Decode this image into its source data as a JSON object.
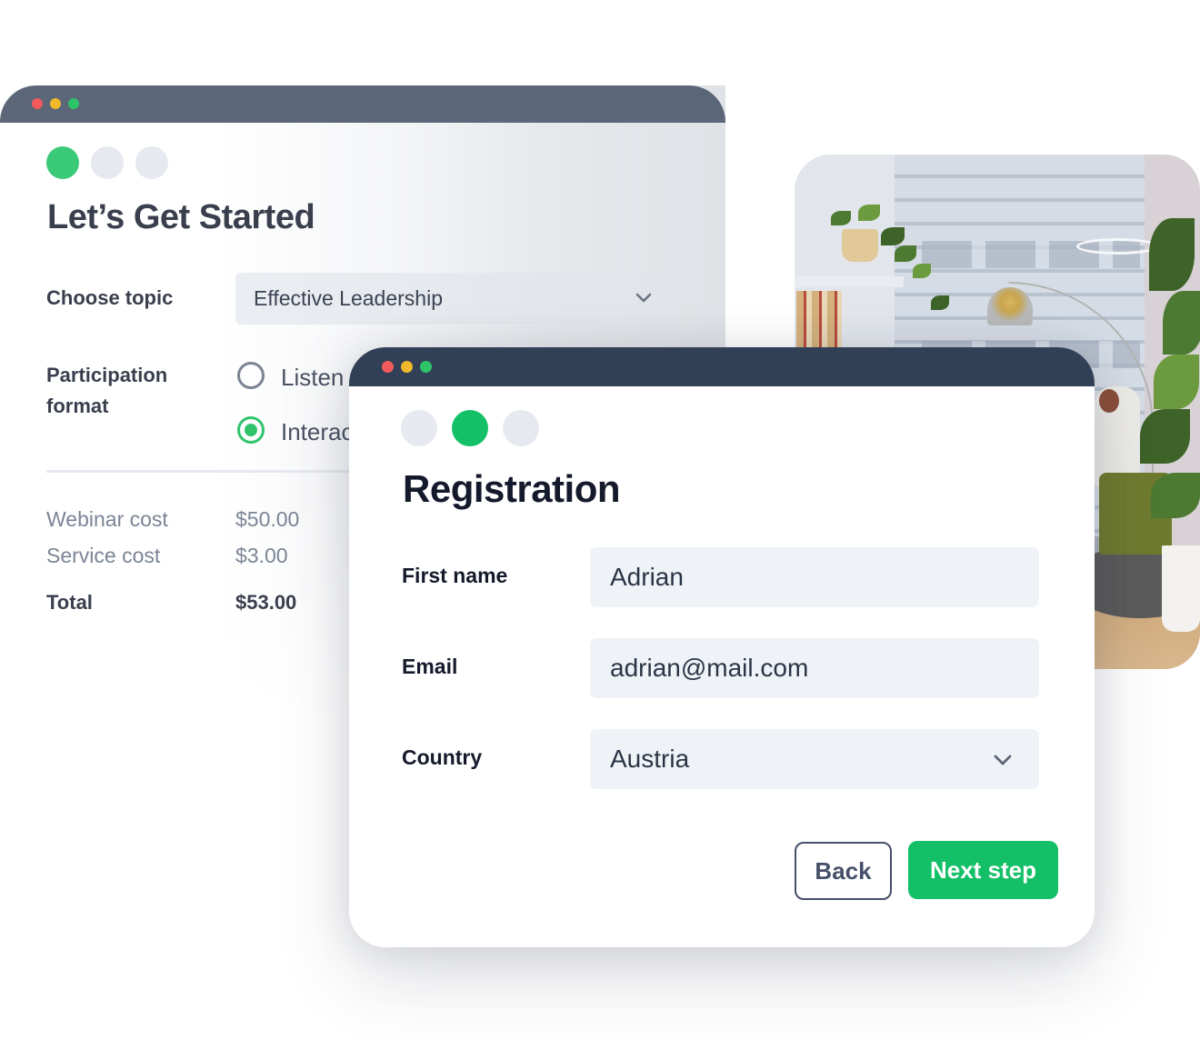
{
  "colors": {
    "accent_green": "#13c067",
    "radio_green": "#31c46c",
    "front_titlebar": "#324057",
    "back_titlebar": "#5b6678",
    "traffic_red": "#f25b5b",
    "traffic_yellow": "#f0b92b",
    "traffic_green": "#2dc468",
    "step_inactive": "#e6e9ef"
  },
  "back_window": {
    "steps": [
      {
        "state": "active"
      },
      {
        "state": "inactive"
      },
      {
        "state": "inactive"
      }
    ],
    "title": "Let’s Get Started",
    "topic": {
      "label": "Choose topic",
      "selected": "Effective Leadership",
      "icon": "chevron-down-icon"
    },
    "participation": {
      "label_line1": "Participation",
      "label_line2": "format",
      "options": [
        {
          "label": "Listener",
          "visible_text": "Listen",
          "checked": false
        },
        {
          "label": "Interactive",
          "visible_text": "Interac",
          "checked": true
        }
      ]
    },
    "costs": [
      {
        "label": "Webinar cost",
        "value": "$50.00"
      },
      {
        "label": "Service cost",
        "value": "$3.00"
      }
    ],
    "total": {
      "label": "Total",
      "value": "$53.00"
    }
  },
  "photo": {
    "description": "office-interior-photo"
  },
  "front_window": {
    "steps": [
      {
        "state": "inactive"
      },
      {
        "state": "active"
      },
      {
        "state": "inactive"
      }
    ],
    "title": "Registration",
    "fields": {
      "first_name": {
        "label": "First name",
        "value": "Adrian"
      },
      "email": {
        "label": "Email",
        "value": "adrian@mail.com"
      },
      "country": {
        "label": "Country",
        "value": "Austria",
        "icon": "chevron-down-icon"
      }
    },
    "buttons": {
      "back": "Back",
      "next": "Next step"
    }
  }
}
